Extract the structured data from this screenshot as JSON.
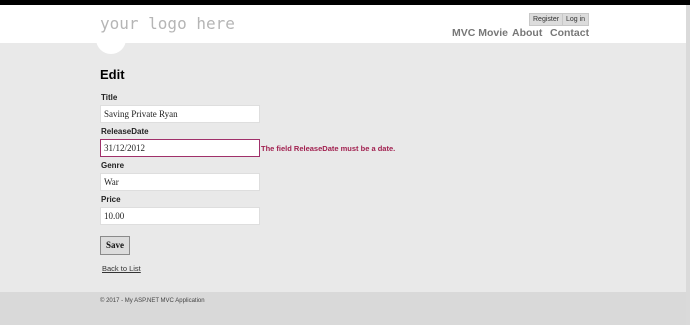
{
  "header": {
    "logo": "your logo here",
    "auth": {
      "register": "Register",
      "login": "Log in"
    },
    "nav": [
      "MVC Movie",
      "About",
      "Contact"
    ]
  },
  "main": {
    "title": "Edit",
    "fields": [
      {
        "label": "Title",
        "value": "Saving Private Ryan"
      },
      {
        "label": "ReleaseDate",
        "value": "31/12/2012",
        "error": "The field ReleaseDate must be a date."
      },
      {
        "label": "Genre",
        "value": "War"
      },
      {
        "label": "Price",
        "value": "10.00"
      }
    ],
    "save_label": "Save",
    "back_link": "Back to List"
  },
  "footer": {
    "text": "© 2017 - My ASP.NET MVC Application"
  },
  "colors": {
    "error": "#a1204f",
    "background": "#e9e9e9",
    "header_bg": "#ffffff"
  }
}
